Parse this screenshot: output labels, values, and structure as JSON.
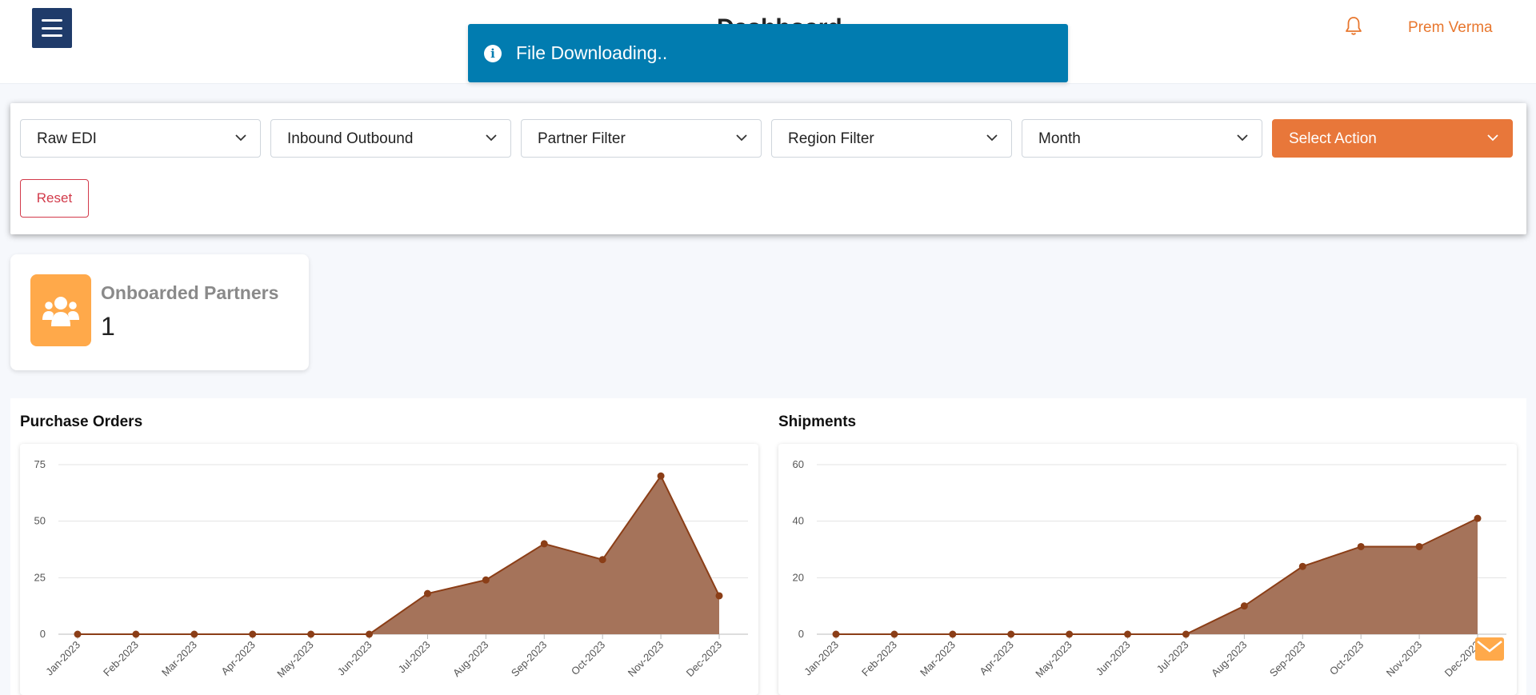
{
  "header": {
    "page_title": "Dashboard",
    "user_name": "Prem Verma"
  },
  "toast": {
    "message": "File Downloading.."
  },
  "filters": {
    "raw_edi": "Raw EDI",
    "direction": "Inbound Outbound",
    "partner": "Partner Filter",
    "region": "Region Filter",
    "period": "Month",
    "action": "Select Action",
    "reset": "Reset"
  },
  "stat": {
    "label": "Onboarded Partners",
    "value": "1"
  },
  "colors": {
    "accent": "#e8773a",
    "toast": "#017cb0",
    "nav": "#1f3b6a",
    "area_fill": "#a5735a",
    "area_line": "#8b3e17"
  },
  "chart_data": [
    {
      "type": "area",
      "title": "Purchase Orders",
      "categories": [
        "Jan-2023",
        "Feb-2023",
        "Mar-2023",
        "Apr-2023",
        "May-2023",
        "Jun-2023",
        "Jul-2023",
        "Aug-2023",
        "Sep-2023",
        "Oct-2023",
        "Nov-2023",
        "Dec-2023"
      ],
      "series": [
        {
          "values": [
            0,
            0,
            0,
            0,
            0,
            0,
            18,
            24,
            40,
            33,
            70,
            17
          ]
        }
      ],
      "yticks": [
        "0",
        "25",
        "50",
        "75"
      ],
      "ylim": [
        0,
        75
      ],
      "grid": true
    },
    {
      "type": "area",
      "title": "Shipments",
      "categories": [
        "Jan-2023",
        "Feb-2023",
        "Mar-2023",
        "Apr-2023",
        "May-2023",
        "Jun-2023",
        "Jul-2023",
        "Aug-2023",
        "Sep-2023",
        "Oct-2023",
        "Nov-2023",
        "Dec-2023"
      ],
      "series": [
        {
          "values": [
            0,
            0,
            0,
            0,
            0,
            0,
            0,
            10,
            24,
            31,
            31,
            41
          ]
        }
      ],
      "yticks": [
        "0",
        "20",
        "40",
        "60"
      ],
      "ylim": [
        0,
        60
      ],
      "grid": true
    }
  ]
}
